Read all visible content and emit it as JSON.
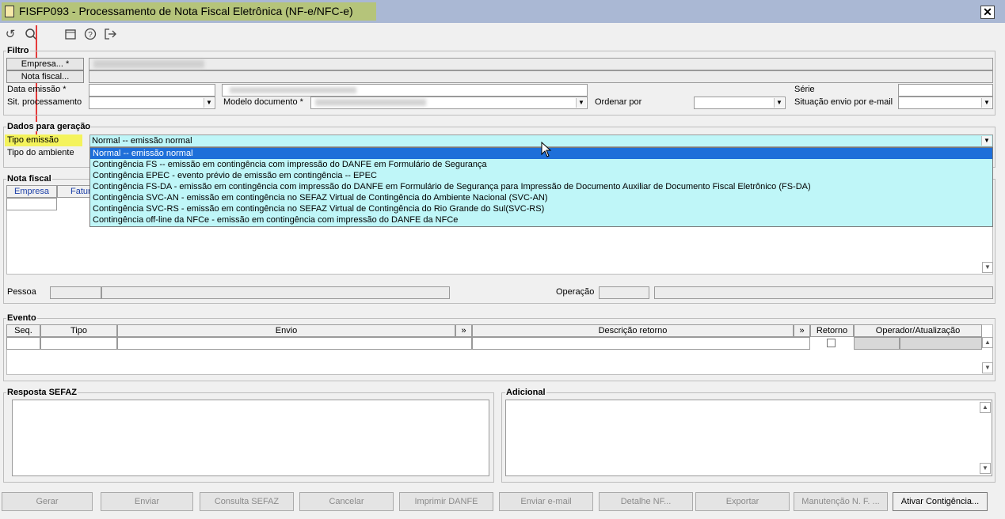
{
  "window": {
    "title": "FISFP093 - Processamento de Nota Fiscal Eletrônica (NF-e/NFC-e)",
    "close_label": "✕"
  },
  "toolbar": {
    "icons": [
      "undo-icon",
      "search-icon",
      "calendar-icon",
      "help-icon",
      "exit-icon"
    ]
  },
  "filtro": {
    "title": "Filtro",
    "empresa_button": "Empresa... *",
    "nota_fiscal_button": "Nota fiscal...",
    "data_emissao_label": "Data emissão *",
    "sit_processamento_label": "Sit. processamento",
    "modelo_documento_label": "Modelo documento *",
    "ordenar_por_label": "Ordenar por",
    "serie_label": "Série",
    "situacao_envio_label": "Situação envio por e-mail"
  },
  "dados": {
    "title": "Dados para geração",
    "tipo_emissao_label": "Tipo emissão",
    "tipo_emissao_value": "Normal -- emissão normal",
    "tipo_ambiente_label": "Tipo do ambiente",
    "options": [
      "Normal -- emissão normal",
      "Contingência FS -- emissão em contingência com impressão do DANFE em Formulário de Segurança",
      "Contingência EPEC - evento prévio de emissão em contingência -- EPEC",
      "Contingência FS-DA - emissão em contingência com impressão do DANFE em Formulário de Segurança para Impressão de Documento Auxiliar de Documento Fiscal Eletrônico (FS-DA)",
      "Contingência SVC-AN - emissão em contingência no SEFAZ Virtual de Contingência do Ambiente Nacional (SVC-AN)",
      "Contingência SVC-RS - emissão em contingência no SEFAZ Virtual de Contingência do Rio Grande do Sul(SVC-RS)",
      "Contingência off-line da NFCe - emissão em contingência com impressão do DANFE da NFCe"
    ]
  },
  "nota_fiscal": {
    "title": "Nota fiscal",
    "col_empresa": "Empresa",
    "col_fatura": "Fatur",
    "pessoa_label": "Pessoa",
    "operacao_label": "Operação"
  },
  "evento": {
    "title": "Evento",
    "columns": [
      "Seq.",
      "Tipo",
      "Envio",
      "»",
      "Descrição retorno",
      "»",
      "Retorno",
      "Operador/Atualização"
    ]
  },
  "resposta": {
    "title": "Resposta SEFAZ"
  },
  "adicional": {
    "title": "Adicional"
  },
  "buttons": {
    "gerar": "Gerar",
    "enviar": "Enviar",
    "consulta": "Consulta SEFAZ",
    "cancelar": "Cancelar",
    "imprimir": "Imprimir DANFE",
    "enviar_email": "Enviar e-mail",
    "detalhe": "Detalhe NF...",
    "exportar": "Exportar",
    "manutencao": "Manutenção N. F. ...",
    "ativar": "Ativar Contigência..."
  }
}
